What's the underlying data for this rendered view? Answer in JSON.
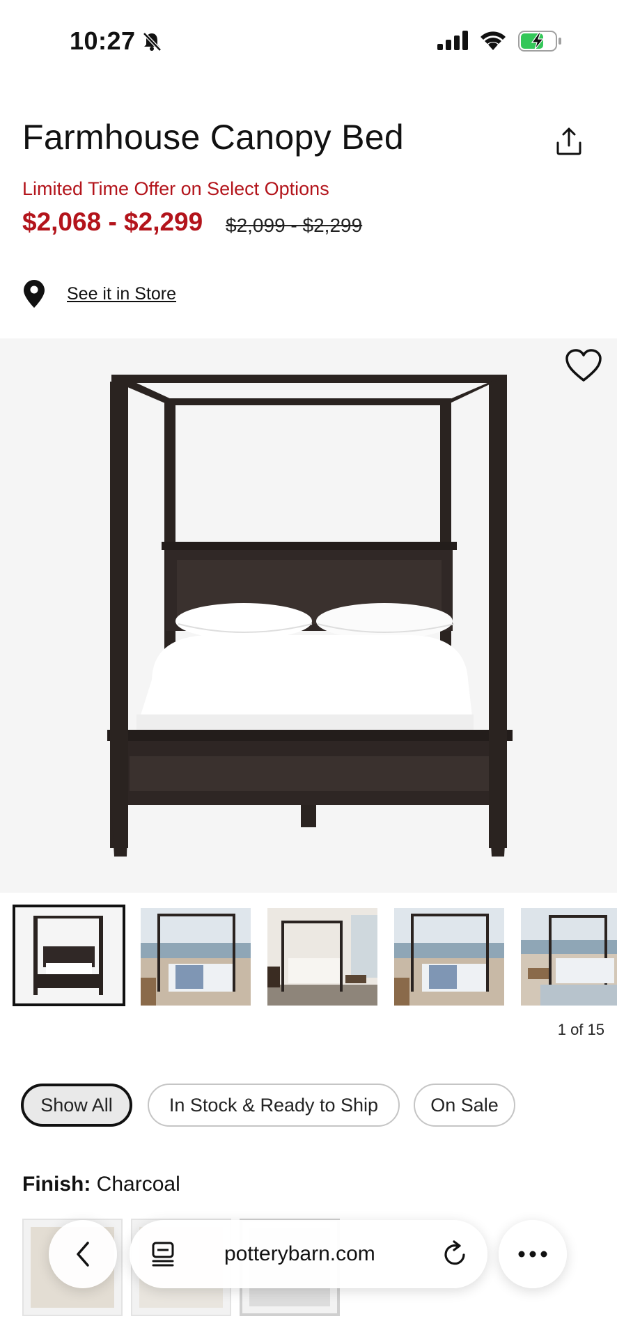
{
  "status_bar": {
    "time": "10:27",
    "icons": [
      "bell-slash-icon",
      "signal-icon",
      "wifi-icon",
      "battery-charging-icon"
    ],
    "battery_color": "#34c759"
  },
  "product": {
    "title": "Farmhouse Canopy Bed",
    "promo": "Limited Time Offer on Select Options",
    "price_range": "$2,068 - $2,299",
    "original_price": "$2,099 - $2,299",
    "store_link": "See it in Store"
  },
  "gallery": {
    "counter": "1 of 15",
    "thumbnails": [
      "studio",
      "beach-bedroom",
      "white-bedroom",
      "beach-bedroom",
      "beach-bedroom"
    ]
  },
  "filters": {
    "chips": [
      "Show All",
      "In Stock & Ready to Ship",
      "On Sale"
    ],
    "active": "Show All"
  },
  "finish": {
    "label": "Finish:",
    "value": "Charcoal"
  },
  "browser": {
    "url": "potterybarn.com",
    "icons": [
      "back-icon",
      "tabs-icon",
      "reload-icon",
      "more-icon"
    ]
  },
  "colors": {
    "sale_red": "#b3141b",
    "wood_dark": "#2a2320",
    "image_bg": "#f5f5f5"
  }
}
